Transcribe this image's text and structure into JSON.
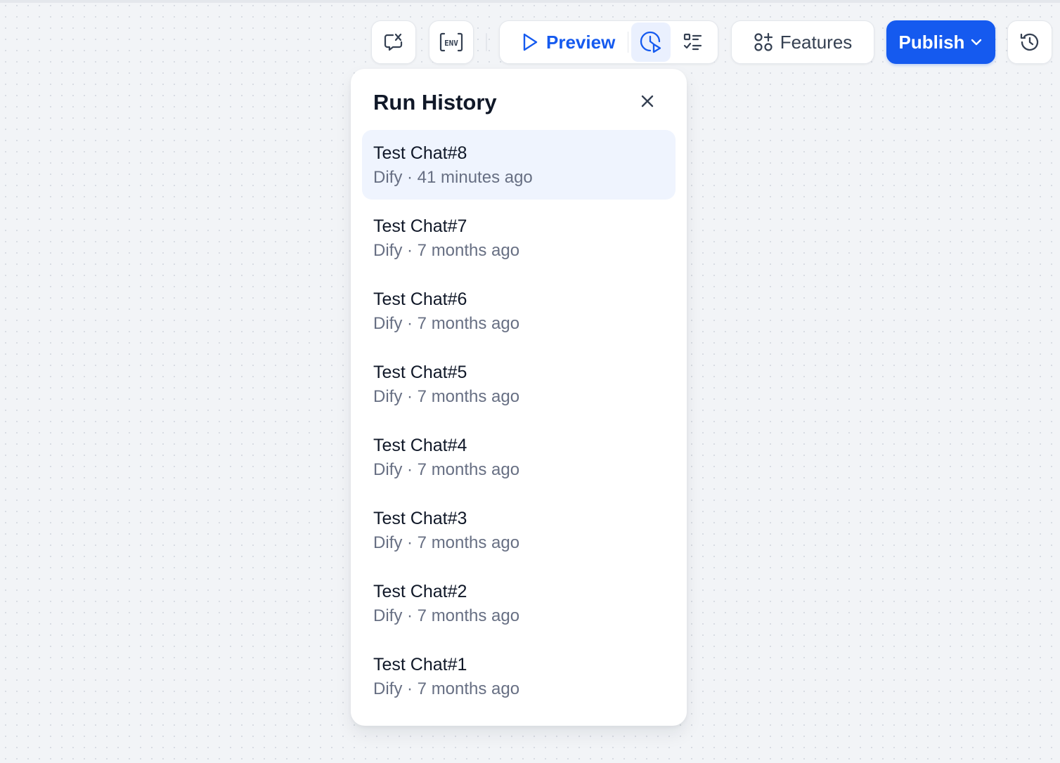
{
  "toolbar": {
    "preview_label": "Preview",
    "features_label": "Features",
    "publish_label": "Publish",
    "env_icon_text": "ENV"
  },
  "panel": {
    "title": "Run History",
    "items": [
      {
        "title": "Test Chat#8",
        "author": "Dify",
        "time": "41 minutes ago",
        "active": true
      },
      {
        "title": "Test Chat#7",
        "author": "Dify",
        "time": "7 months ago"
      },
      {
        "title": "Test Chat#6",
        "author": "Dify",
        "time": "7 months ago"
      },
      {
        "title": "Test Chat#5",
        "author": "Dify",
        "time": "7 months ago"
      },
      {
        "title": "Test Chat#4",
        "author": "Dify",
        "time": "7 months ago"
      },
      {
        "title": "Test Chat#3",
        "author": "Dify",
        "time": "7 months ago"
      },
      {
        "title": "Test Chat#2",
        "author": "Dify",
        "time": "7 months ago"
      },
      {
        "title": "Test Chat#1",
        "author": "Dify",
        "time": "7 months ago"
      }
    ]
  },
  "colors": {
    "accent": "#155aef",
    "active_item_bg": "#eff4fe",
    "canvas_bg": "#f2f4f7"
  }
}
